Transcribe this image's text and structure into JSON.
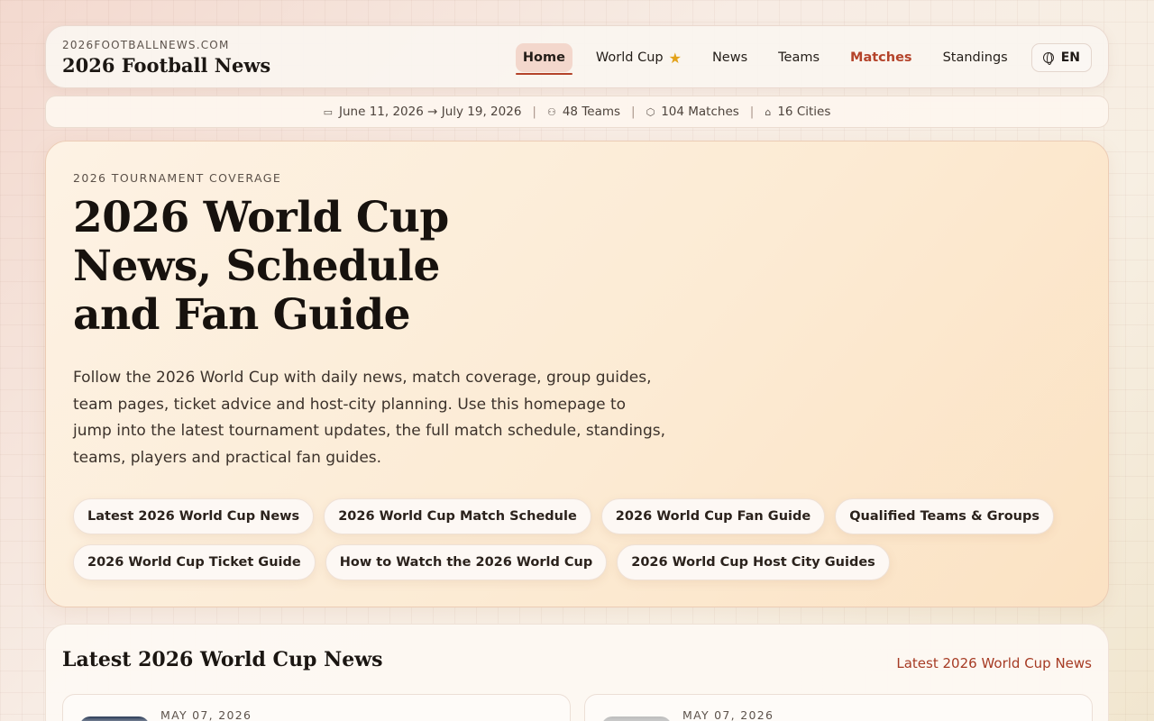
{
  "header": {
    "domain": "2026FOOTBALLNEWS.COM",
    "title": "2026 Football News",
    "nav": [
      {
        "label": "Home"
      },
      {
        "label": "World Cup"
      },
      {
        "label": "News"
      },
      {
        "label": "Teams"
      },
      {
        "label": "Matches"
      },
      {
        "label": "Standings"
      }
    ],
    "lang": "EN"
  },
  "info_strip": {
    "dates": "June 11, 2026 → July 19, 2026",
    "teams": "48 Teams",
    "matches": "104 Matches",
    "cities": "16 Cities",
    "separator": "|"
  },
  "hero": {
    "eyebrow": "2026 TOURNAMENT COVERAGE",
    "title_lines": [
      "2026 World Cup",
      "News, Schedule",
      "and Fan Guide"
    ],
    "description": "Follow the 2026 World Cup with daily news, match coverage, group guides, team pages, ticket advice and host-city planning. Use this homepage to jump into the latest tournament updates, the full match schedule, standings, teams, players and practical fan guides.",
    "chips": [
      "Latest 2026 World Cup News",
      "2026 World Cup Match Schedule",
      "2026 World Cup Fan Guide",
      "Qualified Teams & Groups",
      "2026 World Cup Ticket Guide",
      "How to Watch the 2026 World Cup",
      "2026 World Cup Host City Guides"
    ]
  },
  "news": {
    "title": "Latest 2026 World Cup News",
    "link": "Latest 2026 World Cup News",
    "cards": [
      {
        "date": "MAY 07, 2026"
      },
      {
        "date": "MAY 07, 2026"
      }
    ]
  },
  "colors": {
    "accent": "#b4432a",
    "star": "#e3a21a"
  }
}
